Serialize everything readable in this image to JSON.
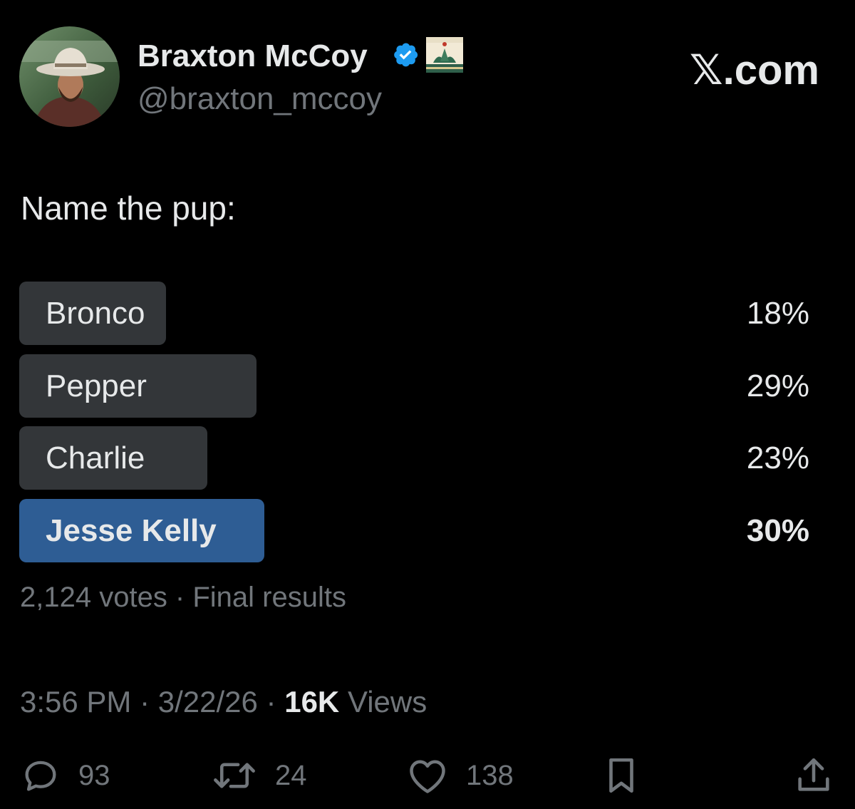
{
  "author": {
    "display_name": "Braxton McCoy",
    "handle": "@braxton_mccoy"
  },
  "site_label": "𝕏.com",
  "tweet": {
    "text": "Name the pup:"
  },
  "poll": {
    "options": [
      {
        "label": "Bronco",
        "percent_text": "18%",
        "percent": 18,
        "winner": false
      },
      {
        "label": "Pepper",
        "percent_text": "29%",
        "percent": 29,
        "winner": false
      },
      {
        "label": "Charlie",
        "percent_text": "23%",
        "percent": 23,
        "winner": false
      },
      {
        "label": "Jesse Kelly",
        "percent_text": "30%",
        "percent": 30,
        "winner": true
      }
    ],
    "summary": "2,124 votes · Final results"
  },
  "meta": {
    "time": "3:56 PM",
    "date": "3/22/26",
    "views_count": "16K",
    "views_label": "Views"
  },
  "actions": {
    "replies": "93",
    "reposts": "24",
    "likes": "138"
  },
  "colors": {
    "background": "#000000",
    "text_primary": "#e7e9ea",
    "text_secondary": "#71767b",
    "poll_bar": "#333639",
    "poll_bar_winner": "#2e5d94",
    "verified_blue": "#1d9bf0"
  }
}
